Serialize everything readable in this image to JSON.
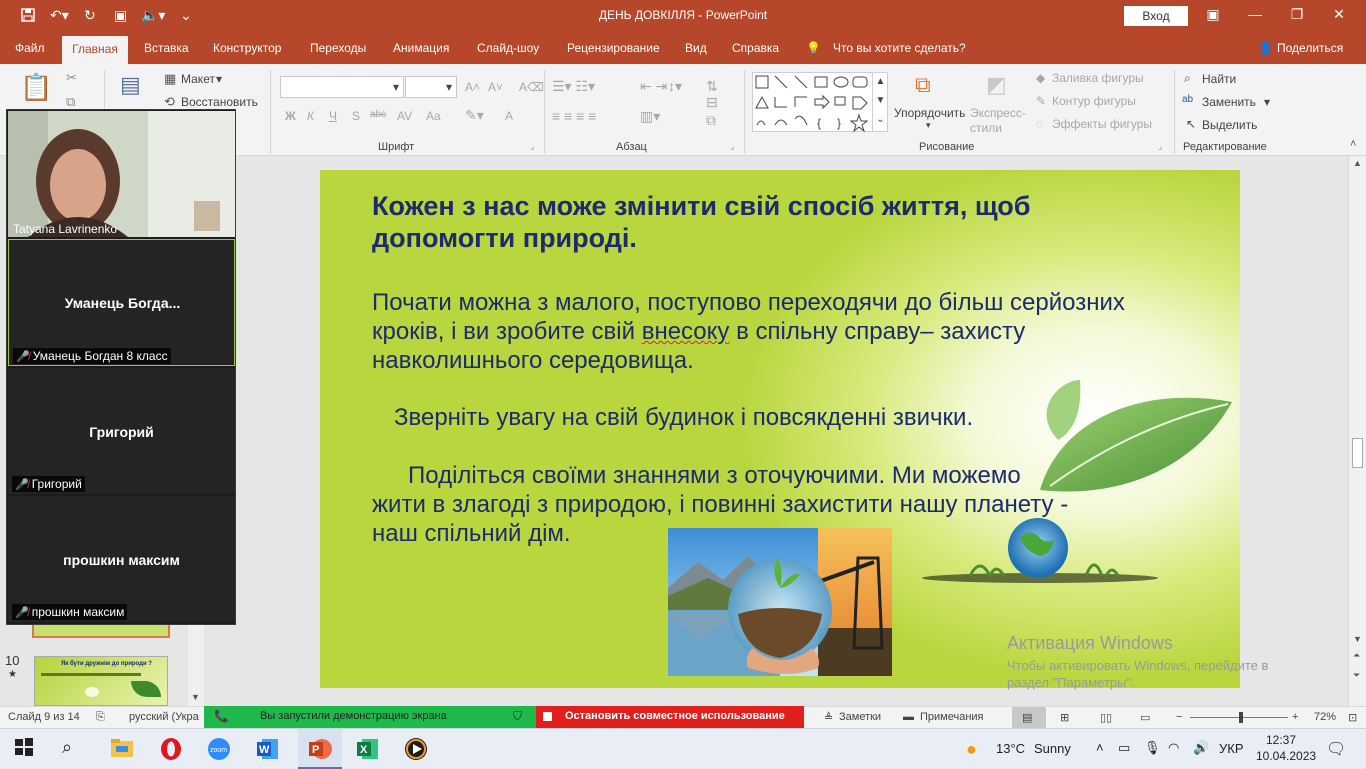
{
  "window": {
    "title": "ДЕНЬ ДОВКІЛЛЯ  -  PowerPoint",
    "signin": "Вход",
    "quick_access": [
      "save-icon",
      "undo-icon",
      "redo-icon",
      "present-icon",
      "audio-icon",
      "more-icon"
    ]
  },
  "tabs": [
    "Файл",
    "Главная",
    "Вставка",
    "Конструктор",
    "Переходы",
    "Анимация",
    "Слайд-шоу",
    "Рецензирование",
    "Вид",
    "Справка"
  ],
  "active_tab": "Главная",
  "tell_me": "Что вы хотите сделать?",
  "share": "Поделиться",
  "ribbon": {
    "slides": {
      "layout": "Макет",
      "reset": "Восстановить"
    },
    "font_group": "Шрифт",
    "paragraph_group": "Абзац",
    "drawing_group": "Рисование",
    "editing_group": "Редактирование",
    "arrange": "Упорядочить",
    "quick_styles": "Экспресс-стили",
    "shape_fill": "Заливка фигуры",
    "shape_outline": "Контур фигуры",
    "shape_effects": "Эффекты фигуры",
    "find": "Найти",
    "replace": "Заменить",
    "select": "Выделить",
    "font_format_buttons": [
      "Ж",
      "К",
      "Ч",
      "S",
      "abc",
      "AV",
      "Aa",
      "A"
    ]
  },
  "slide": {
    "heading": "Кожен з нас може змінити свій спосіб життя, щоб допомогти природі.",
    "p1_before": "Почати можна з малого, поступово переходячи до більш серйозних кроків, і ви зробите свій ",
    "p1_underlined": "внесоку",
    "p1_after": " в спільну справу– захисту навколишнього середовища.",
    "p2": "Зверніть увагу на свій будинок і повсякденні звички.",
    "p3_line1": "Поділіться своїми знаннями з оточуючими. Ми можемо",
    "p3_line2": "жити в злагоді з природою, і повинні захистити нашу планету -",
    "p3_line3": "наш спільний дім."
  },
  "thumbnails": {
    "slide10_number": "10",
    "slide10_star": "★",
    "slide10_title": "Як бути дружнім до природи ?"
  },
  "zoom": {
    "participants": [
      {
        "name": "Tatyana Lavrinenko",
        "video": true
      },
      {
        "name": "Уманець Богдан 8 класс",
        "display": "Уманець  Богда...",
        "muted": true,
        "active": true
      },
      {
        "name": "Григорий",
        "display": "Григорий",
        "muted": true
      },
      {
        "name": "прошкин максим",
        "display": "прошкин максим",
        "muted": true
      }
    ]
  },
  "watermark": {
    "title": "Активация Windows",
    "line1": "Чтобы активировать Windows, перейдите в",
    "line2": "раздел \"Параметры\"."
  },
  "status": {
    "slide_counter": "Слайд 9 из 14",
    "language": "русский (Укра",
    "share_notice": "Вы запустили демонстрацию экрана",
    "stop_share": "Остановить совместное использование",
    "notes": "Заметки",
    "comments": "Примечания",
    "zoom_pct": "72%",
    "zoom_level": 0.52
  },
  "taskbar": {
    "temperature": "13°C",
    "weather": "Sunny",
    "lang": "УКР",
    "time": "12:37",
    "date": "10.04.2023"
  }
}
